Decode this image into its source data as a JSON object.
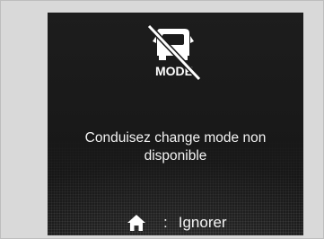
{
  "dialog": {
    "icon_name": "mode-unavailable-icon",
    "icon_label": "MODE",
    "message": "Conduisez change mode non disponible",
    "footer": {
      "icon_name": "home-icon",
      "separator": ":",
      "action_label": "Ignorer"
    }
  },
  "colors": {
    "screen_background": "#1a1a1a",
    "text": "#f2f2f2",
    "frame": "#d9d9d9"
  }
}
